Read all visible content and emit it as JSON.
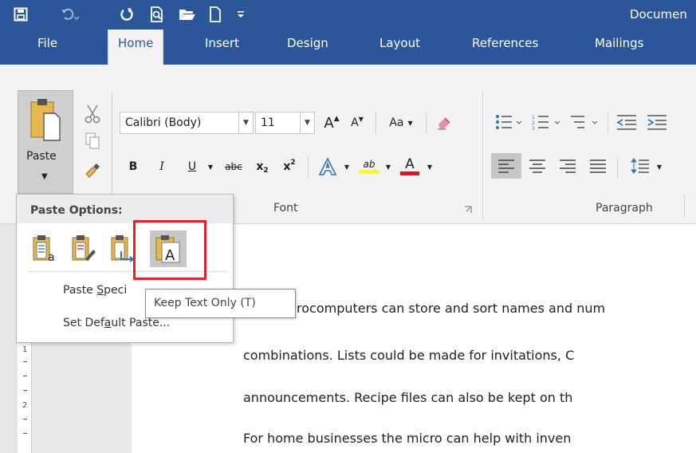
{
  "window": {
    "title": "Documen"
  },
  "quick_access": {
    "icons": [
      "save-icon",
      "undo-icon",
      "redo-icon",
      "print-preview-icon",
      "open-folder-icon",
      "new-document-icon",
      "customize-qat-icon"
    ]
  },
  "tabs": [
    {
      "label": "File",
      "active": false
    },
    {
      "label": "Home",
      "active": true
    },
    {
      "label": "Insert",
      "active": false
    },
    {
      "label": "Design",
      "active": false
    },
    {
      "label": "Layout",
      "active": false
    },
    {
      "label": "References",
      "active": false
    },
    {
      "label": "Mailings",
      "active": false
    }
  ],
  "ribbon": {
    "paste_label": "Paste",
    "font_name": "Calibri (Body)",
    "font_size": "11",
    "change_case_label": "Aa",
    "bold": "B",
    "italic": "I",
    "underline": "U",
    "strikethrough": "abc",
    "subscript": "x",
    "superscript": "x",
    "font_color_letter": "A",
    "highlight_letters": "ab",
    "groups": {
      "font": "Font",
      "paragraph": "Paragraph"
    },
    "colors": {
      "highlight": "#ffff00",
      "font_color": "#e81123",
      "brand": "#2b579a"
    }
  },
  "paste_menu": {
    "header": "Paste Options:",
    "options": [
      {
        "name": "keep-source-formatting",
        "badge": "a"
      },
      {
        "name": "merge-formatting",
        "badge": ""
      },
      {
        "name": "picture",
        "badge": ""
      },
      {
        "name": "keep-text-only",
        "badge": "A",
        "selected": true
      }
    ],
    "items": [
      {
        "pre": "Paste ",
        "key": "S",
        "post": "peci"
      },
      {
        "pre": "Set Def",
        "key": "a",
        "post": "ult Paste..."
      }
    ]
  },
  "tooltip": "Keep Text Only (T)",
  "document": {
    "lines": [
      "rocomputers can store and sort names and num",
      "combinations. Lists could be made for invitations, C",
      "announcements. Recipe files can also be kept on th",
      "For home businesses the micro can help with inven"
    ]
  },
  "ruler": {
    "numbers": [
      "1",
      "2"
    ]
  }
}
